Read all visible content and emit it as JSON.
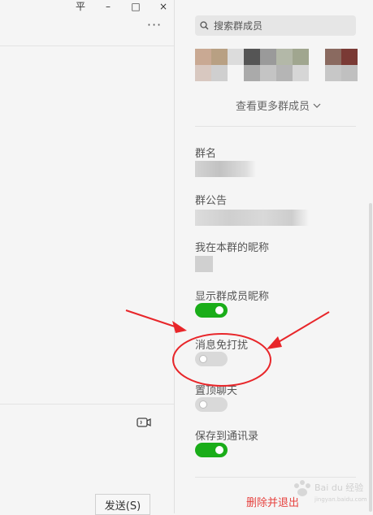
{
  "window": {
    "pin_symbol": "平",
    "minimize_symbol": "–",
    "maximize_symbol": "□",
    "close_symbol": "×",
    "more_symbol": "···"
  },
  "chat": {
    "video_icon": "video-call-icon",
    "send_label": "发送(S)"
  },
  "side": {
    "search_placeholder": "搜索群成员",
    "view_more_members": "查看更多群成员",
    "group_name_label": "群名",
    "group_notice_label": "群公告",
    "my_alias_label": "我在本群的昵称",
    "show_alias_label": "显示群成员昵称",
    "show_alias_on": true,
    "mute_label": "消息免打扰",
    "mute_on": false,
    "pin_chat_label": "置顶聊天",
    "pin_chat_on": false,
    "save_contacts_label": "保存到通讯录",
    "save_contacts_on": true,
    "delete_exit_label": "删除并退出"
  },
  "colors": {
    "toggle_on": "#1aad19",
    "toggle_off": "#d9d9d9",
    "danger": "#e64340",
    "annotation": "#e8262a"
  },
  "watermark": {
    "text": "Bai du 经验",
    "sub": "jingyan.baidu.com"
  }
}
